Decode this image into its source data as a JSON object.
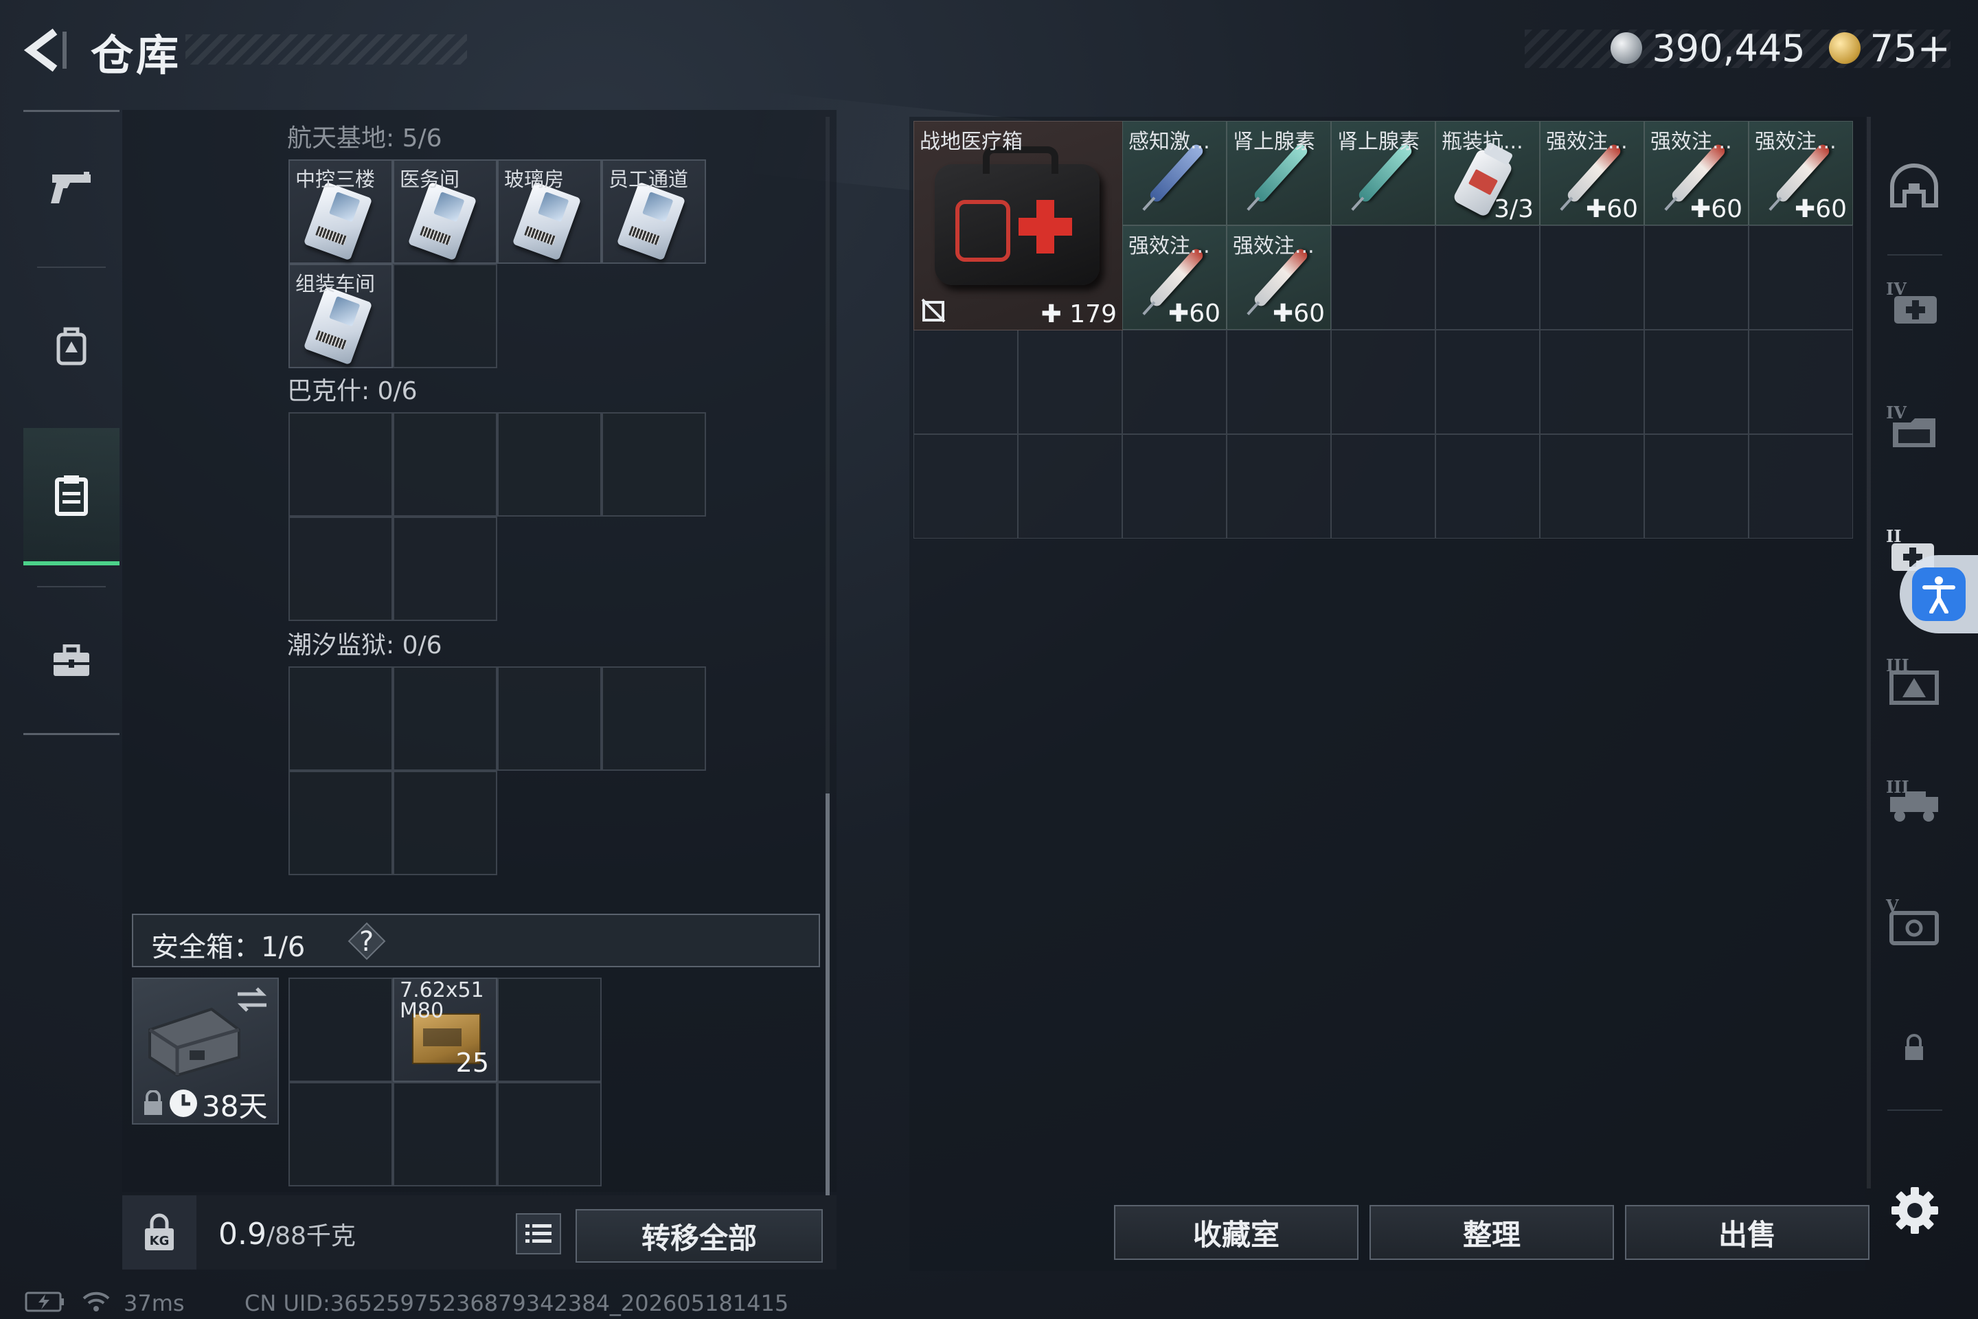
{
  "header": {
    "title": "仓库",
    "currencies": [
      {
        "icon": "silver-coin-icon",
        "value": "390,445"
      },
      {
        "icon": "gold-coin-icon",
        "value": "75"
      }
    ],
    "gold_plus": "+"
  },
  "left_nav": {
    "items": [
      {
        "icon": "pistol-icon",
        "active": false
      },
      {
        "icon": "backpack-icon",
        "active": false
      },
      {
        "icon": "clipboard-icon",
        "active": true
      },
      {
        "icon": "toolbox-icon",
        "active": false
      }
    ]
  },
  "stash_sections": [
    {
      "label": "航天基地: 5/6",
      "items": [
        "中控三楼",
        "医务间",
        "玻璃房",
        "员工通道",
        "组装车间"
      ]
    },
    {
      "label": "巴克什: 0/6",
      "items": []
    },
    {
      "label": "潮汐监狱: 0/6",
      "items": []
    }
  ],
  "safe_box": {
    "title": "安全箱：1/6",
    "help": "?",
    "days": "38天",
    "ammo": {
      "label_line1": "7.62x51",
      "label_line2": "M80",
      "count": "25"
    }
  },
  "weight": {
    "current": "0.9",
    "capacity": "/88千克"
  },
  "transfer_all": "转移全部",
  "med_items": [
    {
      "name": "战地医疗箱",
      "value": "179",
      "size": "large",
      "art": "medkit"
    },
    {
      "name": "感知激...",
      "value": "",
      "art": "syringe-blue"
    },
    {
      "name": "肾上腺素",
      "value": "",
      "art": "syringe-teal"
    },
    {
      "name": "肾上腺素",
      "value": "",
      "art": "syringe-teal"
    },
    {
      "name": "瓶装抗...",
      "value": "3/3",
      "art": "bottle"
    },
    {
      "name": "强效注...",
      "value": "60",
      "art": "syringe-red"
    },
    {
      "name": "强效注...",
      "value": "60",
      "art": "syringe-red"
    },
    {
      "name": "强效注...",
      "value": "60",
      "art": "syringe-red"
    },
    {
      "name": "强效注...",
      "value": "60",
      "art": "syringe-red"
    },
    {
      "name": "强效注...",
      "value": "60",
      "art": "syringe-red"
    }
  ],
  "right_categories": [
    {
      "icon": "helmet-icon"
    },
    {
      "icon": "medkit-tier-4-icon",
      "tier": "IV"
    },
    {
      "icon": "folder-tier-4-icon",
      "tier": "IV"
    },
    {
      "icon": "medkit-tier-2-icon",
      "tier": "II"
    },
    {
      "icon": "frame-tier-3-icon",
      "tier": "III"
    },
    {
      "icon": "vehicle-tier-3-icon",
      "tier": "III"
    },
    {
      "icon": "safe-tier-5-icon",
      "tier": "V"
    },
    {
      "icon": "lock-icon"
    }
  ],
  "actions": {
    "collection": "收藏室",
    "organize": "整理",
    "sell": "出售"
  },
  "status": {
    "ping": "37ms",
    "uid": "CN UID:36525975236879342384_202605181415"
  },
  "colors": {
    "accent_green": "#4cd28a",
    "access_blue": "#2f7de8",
    "medkit_red": "#d8312a"
  }
}
